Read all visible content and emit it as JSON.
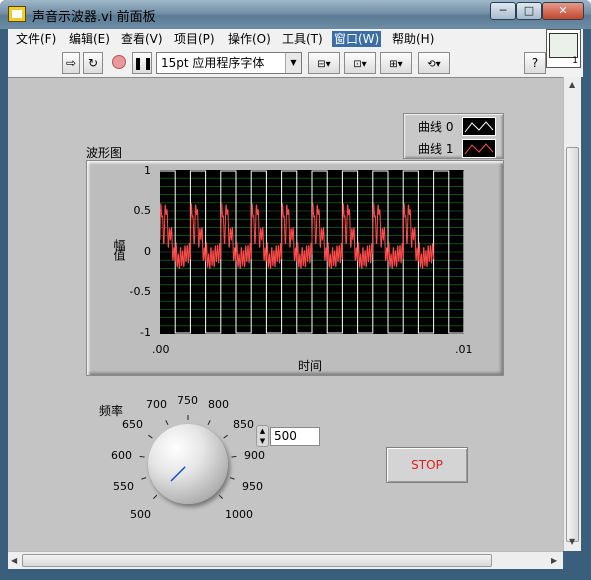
{
  "window": {
    "title": "声音示波器.vi 前面板",
    "minimize": "─",
    "maximize": "□",
    "close": "✕"
  },
  "menu": [
    "文件(F)",
    "编辑(E)",
    "查看(V)",
    "项目(P)",
    "操作(O)",
    "工具(T)",
    "窗口(W)",
    "帮助(H)"
  ],
  "menu_active": "窗口(W)",
  "toolbar": {
    "run_icon": "run-arrow-icon",
    "run_continuously_icon": "run-continuously-icon",
    "abort_icon": "abort-icon",
    "pause_icon": "pause-icon",
    "font": "15pt 应用程序字体",
    "help": "?"
  },
  "vi_icon_number": "1",
  "graph": {
    "label": "波形图",
    "xlabel": "时间",
    "ylabel": "幅值",
    "yticks": [
      "1",
      "0.5",
      "0",
      "-0.5",
      "-1"
    ],
    "xticks": [
      ".00",
      ".01"
    ],
    "legend": [
      "曲线 0",
      "曲线 1"
    ]
  },
  "knob": {
    "label": "频率",
    "ticks": [
      "500",
      "550",
      "600",
      "650",
      "700",
      "750",
      "800",
      "850",
      "900",
      "950",
      "1000"
    ],
    "value": 500,
    "min": 500,
    "max": 1000
  },
  "numeric": {
    "value": "500"
  },
  "stop": {
    "label": "STOP"
  },
  "colors": {
    "plot0": "#ffffff",
    "plot1": "#ff4a4a",
    "grid": "#1f7a1f"
  },
  "chart_data": {
    "type": "line",
    "xlim": [
      0,
      0.01
    ],
    "ylim": [
      -1,
      1
    ],
    "grid": true,
    "series": [
      {
        "name": "曲线 0",
        "kind": "square",
        "freq_hz": 1000,
        "amplitude": 1
      },
      {
        "name": "曲线 1",
        "kind": "decaying oscillation per period",
        "freq_hz": 1000,
        "amplitude": 0.95,
        "x_end": 0.009
      }
    ]
  }
}
